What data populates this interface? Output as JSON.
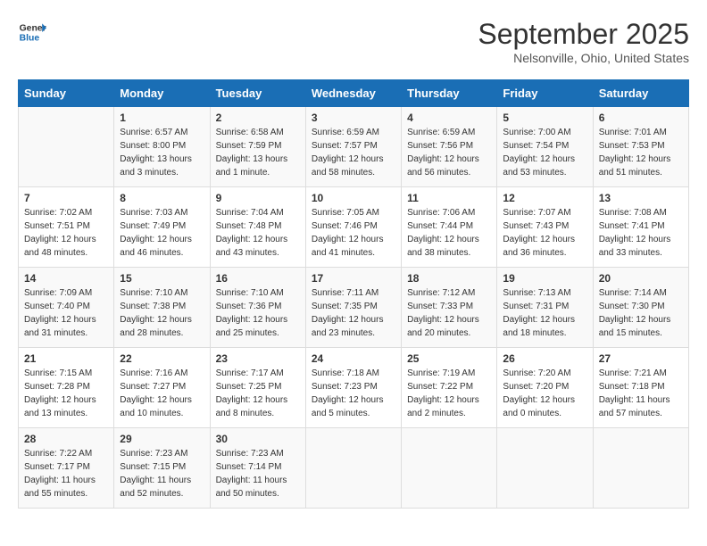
{
  "header": {
    "logo_line1": "General",
    "logo_line2": "Blue",
    "month_title": "September 2025",
    "location": "Nelsonville, Ohio, United States"
  },
  "weekdays": [
    "Sunday",
    "Monday",
    "Tuesday",
    "Wednesday",
    "Thursday",
    "Friday",
    "Saturday"
  ],
  "weeks": [
    [
      {
        "day": "",
        "info": ""
      },
      {
        "day": "1",
        "info": "Sunrise: 6:57 AM\nSunset: 8:00 PM\nDaylight: 13 hours\nand 3 minutes."
      },
      {
        "day": "2",
        "info": "Sunrise: 6:58 AM\nSunset: 7:59 PM\nDaylight: 13 hours\nand 1 minute."
      },
      {
        "day": "3",
        "info": "Sunrise: 6:59 AM\nSunset: 7:57 PM\nDaylight: 12 hours\nand 58 minutes."
      },
      {
        "day": "4",
        "info": "Sunrise: 6:59 AM\nSunset: 7:56 PM\nDaylight: 12 hours\nand 56 minutes."
      },
      {
        "day": "5",
        "info": "Sunrise: 7:00 AM\nSunset: 7:54 PM\nDaylight: 12 hours\nand 53 minutes."
      },
      {
        "day": "6",
        "info": "Sunrise: 7:01 AM\nSunset: 7:53 PM\nDaylight: 12 hours\nand 51 minutes."
      }
    ],
    [
      {
        "day": "7",
        "info": "Sunrise: 7:02 AM\nSunset: 7:51 PM\nDaylight: 12 hours\nand 48 minutes."
      },
      {
        "day": "8",
        "info": "Sunrise: 7:03 AM\nSunset: 7:49 PM\nDaylight: 12 hours\nand 46 minutes."
      },
      {
        "day": "9",
        "info": "Sunrise: 7:04 AM\nSunset: 7:48 PM\nDaylight: 12 hours\nand 43 minutes."
      },
      {
        "day": "10",
        "info": "Sunrise: 7:05 AM\nSunset: 7:46 PM\nDaylight: 12 hours\nand 41 minutes."
      },
      {
        "day": "11",
        "info": "Sunrise: 7:06 AM\nSunset: 7:44 PM\nDaylight: 12 hours\nand 38 minutes."
      },
      {
        "day": "12",
        "info": "Sunrise: 7:07 AM\nSunset: 7:43 PM\nDaylight: 12 hours\nand 36 minutes."
      },
      {
        "day": "13",
        "info": "Sunrise: 7:08 AM\nSunset: 7:41 PM\nDaylight: 12 hours\nand 33 minutes."
      }
    ],
    [
      {
        "day": "14",
        "info": "Sunrise: 7:09 AM\nSunset: 7:40 PM\nDaylight: 12 hours\nand 31 minutes."
      },
      {
        "day": "15",
        "info": "Sunrise: 7:10 AM\nSunset: 7:38 PM\nDaylight: 12 hours\nand 28 minutes."
      },
      {
        "day": "16",
        "info": "Sunrise: 7:10 AM\nSunset: 7:36 PM\nDaylight: 12 hours\nand 25 minutes."
      },
      {
        "day": "17",
        "info": "Sunrise: 7:11 AM\nSunset: 7:35 PM\nDaylight: 12 hours\nand 23 minutes."
      },
      {
        "day": "18",
        "info": "Sunrise: 7:12 AM\nSunset: 7:33 PM\nDaylight: 12 hours\nand 20 minutes."
      },
      {
        "day": "19",
        "info": "Sunrise: 7:13 AM\nSunset: 7:31 PM\nDaylight: 12 hours\nand 18 minutes."
      },
      {
        "day": "20",
        "info": "Sunrise: 7:14 AM\nSunset: 7:30 PM\nDaylight: 12 hours\nand 15 minutes."
      }
    ],
    [
      {
        "day": "21",
        "info": "Sunrise: 7:15 AM\nSunset: 7:28 PM\nDaylight: 12 hours\nand 13 minutes."
      },
      {
        "day": "22",
        "info": "Sunrise: 7:16 AM\nSunset: 7:27 PM\nDaylight: 12 hours\nand 10 minutes."
      },
      {
        "day": "23",
        "info": "Sunrise: 7:17 AM\nSunset: 7:25 PM\nDaylight: 12 hours\nand 8 minutes."
      },
      {
        "day": "24",
        "info": "Sunrise: 7:18 AM\nSunset: 7:23 PM\nDaylight: 12 hours\nand 5 minutes."
      },
      {
        "day": "25",
        "info": "Sunrise: 7:19 AM\nSunset: 7:22 PM\nDaylight: 12 hours\nand 2 minutes."
      },
      {
        "day": "26",
        "info": "Sunrise: 7:20 AM\nSunset: 7:20 PM\nDaylight: 12 hours\nand 0 minutes."
      },
      {
        "day": "27",
        "info": "Sunrise: 7:21 AM\nSunset: 7:18 PM\nDaylight: 11 hours\nand 57 minutes."
      }
    ],
    [
      {
        "day": "28",
        "info": "Sunrise: 7:22 AM\nSunset: 7:17 PM\nDaylight: 11 hours\nand 55 minutes."
      },
      {
        "day": "29",
        "info": "Sunrise: 7:23 AM\nSunset: 7:15 PM\nDaylight: 11 hours\nand 52 minutes."
      },
      {
        "day": "30",
        "info": "Sunrise: 7:23 AM\nSunset: 7:14 PM\nDaylight: 11 hours\nand 50 minutes."
      },
      {
        "day": "",
        "info": ""
      },
      {
        "day": "",
        "info": ""
      },
      {
        "day": "",
        "info": ""
      },
      {
        "day": "",
        "info": ""
      }
    ]
  ]
}
